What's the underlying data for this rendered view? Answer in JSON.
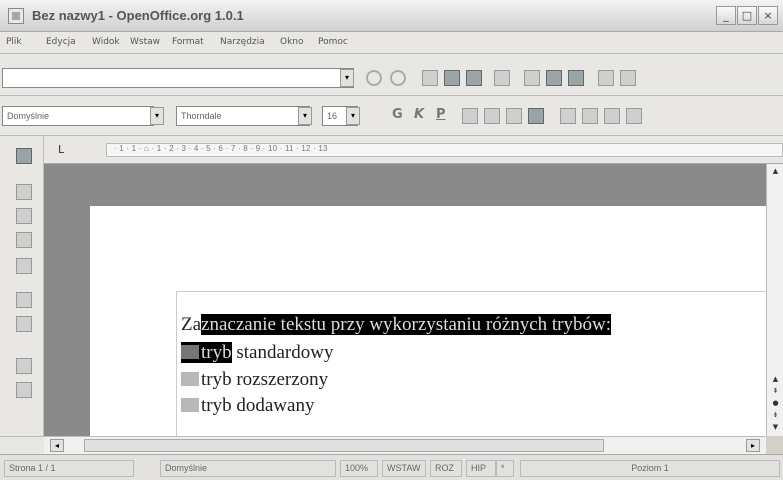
{
  "window": {
    "title": "Bez nazwy1 - OpenOffice.org 1.0.1",
    "minimize": "_",
    "maximize": "□",
    "close": "×"
  },
  "menu": [
    "Plik",
    "Edycja",
    "Widok",
    "Wstaw",
    "Format",
    "Narzędzia",
    "Okno",
    "Pomoc"
  ],
  "toolbar": {
    "url_value": "",
    "dropdown_arrow": "▾"
  },
  "format_bar": {
    "paragraph_style": "Domyślnie",
    "font_name": "Thorndale",
    "font_size": "16",
    "bold": "G",
    "italic": "K",
    "underline": "P"
  },
  "ruler": {
    "tab_indicator": "L",
    "numbers": "· 1 · 1 · ⌂ · 1 · 2 · 3 · 4 · 5 · 6 · 7 · 8 · 9 · 10 · 11 · 12 · 13"
  },
  "document": {
    "line1_plain": "Za",
    "line1_selected": "znaczanie tekstu przy wykorzystaniu różnych trybów:",
    "line2_selected": "tryb",
    "line2_selected_visible": "tryb",
    "line2_rest": "standardowy",
    "line3": "tryb rozszerzony",
    "line4": "tryb dodawany"
  },
  "status": {
    "page": "Strona 1 / 1",
    "style": "Domyślnie",
    "zoom": "100%",
    "insert_mode": "WSTAW",
    "selection_mode": "ROZ",
    "hyperlink_mode": "HIP",
    "star": "*",
    "right": "Poziom 1"
  }
}
